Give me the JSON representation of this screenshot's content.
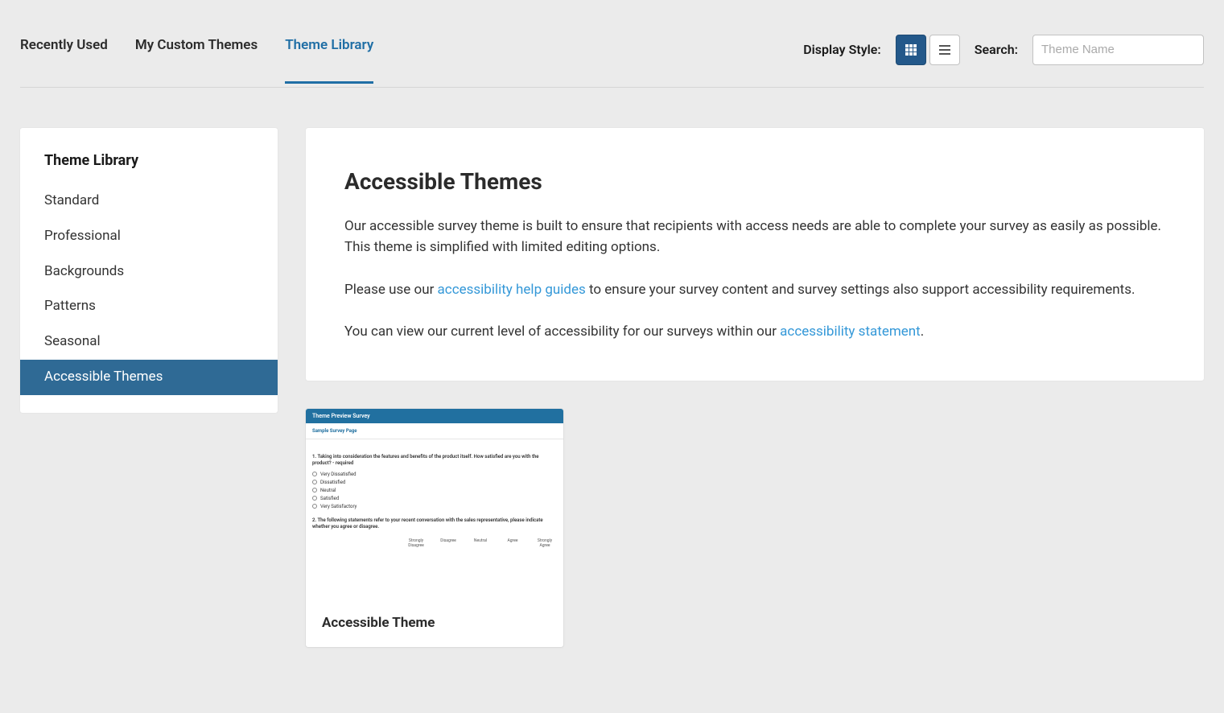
{
  "tabs": {
    "recent": "Recently Used",
    "custom": "My Custom Themes",
    "library": "Theme Library"
  },
  "controls": {
    "display_label": "Display Style:",
    "search_label": "Search:",
    "search_placeholder": "Theme Name"
  },
  "sidebar": {
    "title": "Theme Library",
    "items": [
      "Standard",
      "Professional",
      "Backgrounds",
      "Patterns",
      "Seasonal",
      "Accessible Themes"
    ]
  },
  "info": {
    "title": "Accessible Themes",
    "p1": "Our accessible survey theme is built to ensure that recipients with access needs are able to complete your survey as easily as possible. This theme is simplified with limited editing options.",
    "p2a": "Please use our ",
    "p2_link": "accessibility help guides",
    "p2b": " to ensure your survey content and survey settings also support accessibility requirements.",
    "p3a": "You can view our current level of accessibility for our surveys within our ",
    "p3_link": "accessibility statement",
    "p3b": "."
  },
  "theme": {
    "name": "Accessible Theme",
    "preview": {
      "header": "Theme Preview Survey",
      "page_title": "Sample Survey Page",
      "q1": "1. Taking into consideration the features and benefits of the product itself. How satisfied are you with the product? - required",
      "opts": [
        "Very Dissatisfied",
        "Dissatisfied",
        "Neutral",
        "Satisfied",
        "Very Satisfactory"
      ],
      "q2": "2. The following statements refer to your recent conversation with the sales representative, please indicate whether you agree or disagree.",
      "matrix_cols": [
        "Strongly Disagree",
        "Disagree",
        "Neutral",
        "Agree",
        "Strongly Agree"
      ]
    }
  }
}
